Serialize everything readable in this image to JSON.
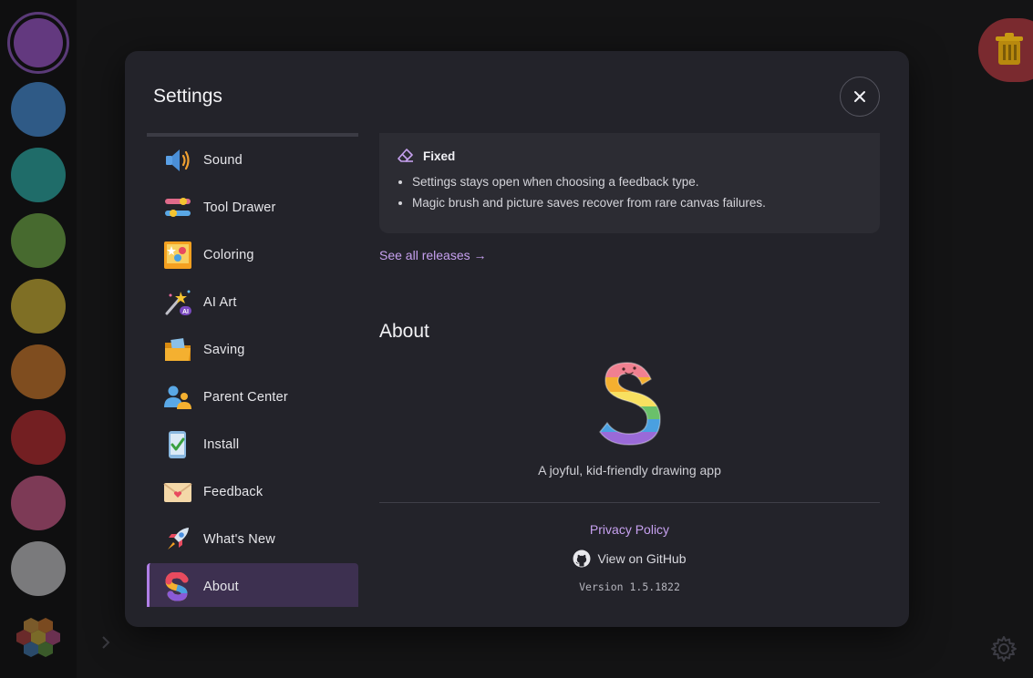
{
  "palette": {
    "colors": [
      "#8a45c8",
      "#3f80c8",
      "#259c95",
      "#5ea43c",
      "#c6ad2c",
      "#cf7a26",
      "#b82a2a",
      "#c8527e",
      "#bbbbbb"
    ],
    "selected_index": 0,
    "hex_icon": "hexagon-palette-icon"
  },
  "settings": {
    "title": "Settings",
    "close_icon": "close-icon",
    "nav": [
      {
        "label": "Sound",
        "icon": "speaker-icon"
      },
      {
        "label": "Tool Drawer",
        "icon": "sliders-icon"
      },
      {
        "label": "Coloring",
        "icon": "coloring-book-icon"
      },
      {
        "label": "AI Art",
        "icon": "magic-wand-icon"
      },
      {
        "label": "Saving",
        "icon": "folder-icon"
      },
      {
        "label": "Parent Center",
        "icon": "parents-icon"
      },
      {
        "label": "Install",
        "icon": "phone-check-icon"
      },
      {
        "label": "Feedback",
        "icon": "envelope-heart-icon"
      },
      {
        "label": "What's New",
        "icon": "rocket-icon"
      },
      {
        "label": "About",
        "icon": "app-s-logo-icon"
      }
    ],
    "active_nav": "About"
  },
  "release": {
    "section_label": "Fixed",
    "section_icon": "eraser-icon",
    "items": [
      "Settings stays open when choosing a feedback type.",
      "Magic brush and picture saves recover from rare canvas failures."
    ],
    "see_all": "See all releases →"
  },
  "about": {
    "heading": "About",
    "tagline": "A joyful, kid-friendly drawing app",
    "privacy": "Privacy Policy",
    "github": "View on GitHub",
    "version": "Version 1.5.1822"
  },
  "accent_color": "#b07fe6"
}
